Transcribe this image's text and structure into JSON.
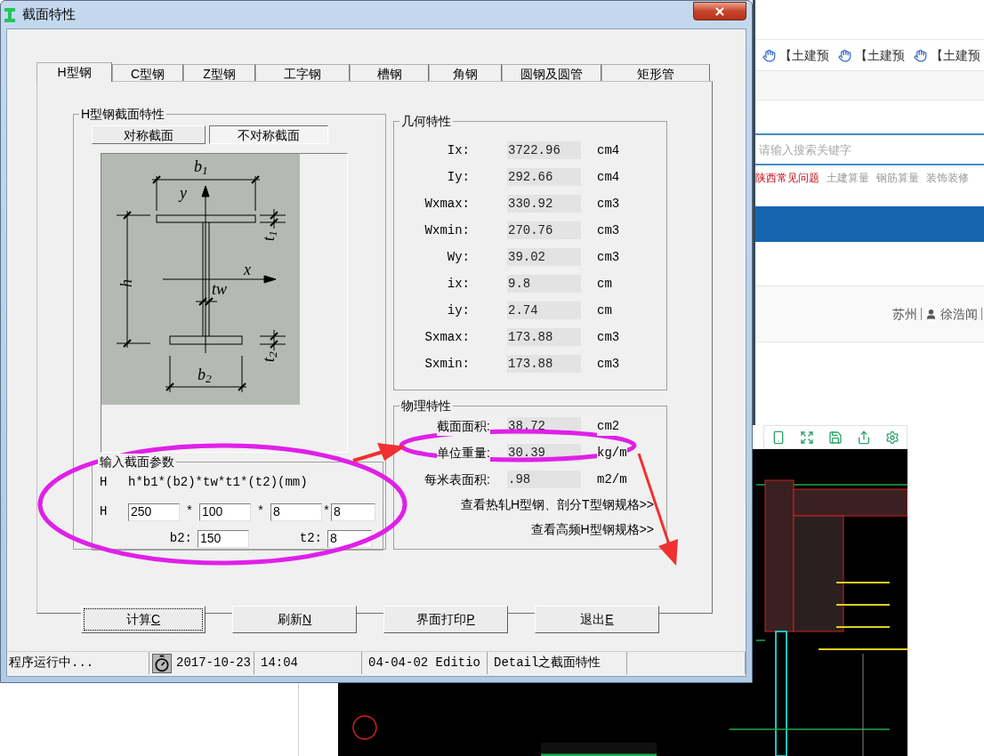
{
  "window": {
    "title": "截面特性"
  },
  "tabs": [
    {
      "label": "H型钢",
      "selected": true
    },
    {
      "label": "C型钢",
      "selected": false
    },
    {
      "label": "Z型钢",
      "selected": false
    },
    {
      "label": "工字钢",
      "selected": false
    },
    {
      "label": "槽钢",
      "selected": false
    },
    {
      "label": "角钢",
      "selected": false
    },
    {
      "label": "圆钢及圆管",
      "selected": false
    },
    {
      "label": "矩形管",
      "selected": false
    }
  ],
  "section_group": {
    "title": "H型钢截面特性",
    "buttons": [
      {
        "label": "对称截面",
        "selected": false
      },
      {
        "label": "不对称截面",
        "selected": true
      }
    ]
  },
  "diagram": {
    "labels": [
      "b$_{1}$",
      "y",
      "t$_{1}$",
      "h",
      "x",
      "tw",
      "t$_{2}$",
      "b$_{2}$"
    ]
  },
  "input": {
    "title": "输入截面参数",
    "formula": {
      "prefix": "H",
      "text": "h*b1*(b2)*tw*t1*(t2)(mm)"
    },
    "row_label": "H",
    "fields": [
      {
        "value": "250"
      },
      {
        "separator": "*",
        "value": "100"
      },
      {
        "separator": "*",
        "value": "8"
      },
      {
        "separator": "*",
        "value": "8"
      }
    ],
    "extra_fields": [
      {
        "label": "b2:",
        "value": "150"
      },
      {
        "label": "t2:",
        "value": "8"
      }
    ]
  },
  "geometry": {
    "title": "几何特性",
    "rows": [
      {
        "label": "Ix:",
        "value": "3722.96",
        "unit": "cm4"
      },
      {
        "label": "Iy:",
        "value": "292.66",
        "unit": "cm4"
      },
      {
        "label": "Wxmax:",
        "value": "330.92",
        "unit": "cm3"
      },
      {
        "label": "Wxmin:",
        "value": "270.76",
        "unit": "cm3"
      },
      {
        "label": "Wy:",
        "value": "39.02",
        "unit": "cm3"
      },
      {
        "label": "ix:",
        "value": "9.8",
        "unit": "cm"
      },
      {
        "label": "iy:",
        "value": "2.74",
        "unit": "cm"
      },
      {
        "label": "Sxmax:",
        "value": "173.88",
        "unit": "cm3"
      },
      {
        "label": "Sxmin:",
        "value": "173.88",
        "unit": "cm3"
      }
    ]
  },
  "physical": {
    "title": "物理特性",
    "rows": [
      {
        "label": "截面面积:",
        "value": "38.72",
        "unit": "cm2"
      },
      {
        "label": "单位重量:",
        "value": "30.39",
        "unit": "kg/m"
      },
      {
        "label": "每米表面积:",
        "value": ".98",
        "unit": "m2/m"
      }
    ],
    "links": [
      "查看热轧H型钢、剖分T型钢规格>>",
      "查看高频H型钢规格>>"
    ]
  },
  "buttons": [
    {
      "label": "计算",
      "accelerator": "C",
      "focused": true
    },
    {
      "label": "刷新",
      "accelerator": "N",
      "focused": false
    },
    {
      "label": "界面打印",
      "accelerator": "P",
      "focused": false
    },
    {
      "label": "退出",
      "accelerator": "E",
      "focused": false
    }
  ],
  "status_bar": {
    "message": "程序运行中...",
    "date": "2017-10-23",
    "time": "14:04",
    "edition": "04-04-02 Editio",
    "module": "Detail之截面特性"
  },
  "web_page": {
    "links": [
      "【土建预",
      "【土建预",
      "【土建预"
    ],
    "search": {
      "placeholder": "请输入搜索关键字"
    },
    "categories": [
      {
        "label": "陕西常见问题",
        "selected": true
      },
      {
        "label": "土建算量",
        "selected": false
      },
      {
        "label": "钢筋算量",
        "selected": false
      },
      {
        "label": "装饰装修",
        "selected": false
      }
    ],
    "user": {
      "city": "苏州",
      "name": "徐浩闻"
    }
  }
}
